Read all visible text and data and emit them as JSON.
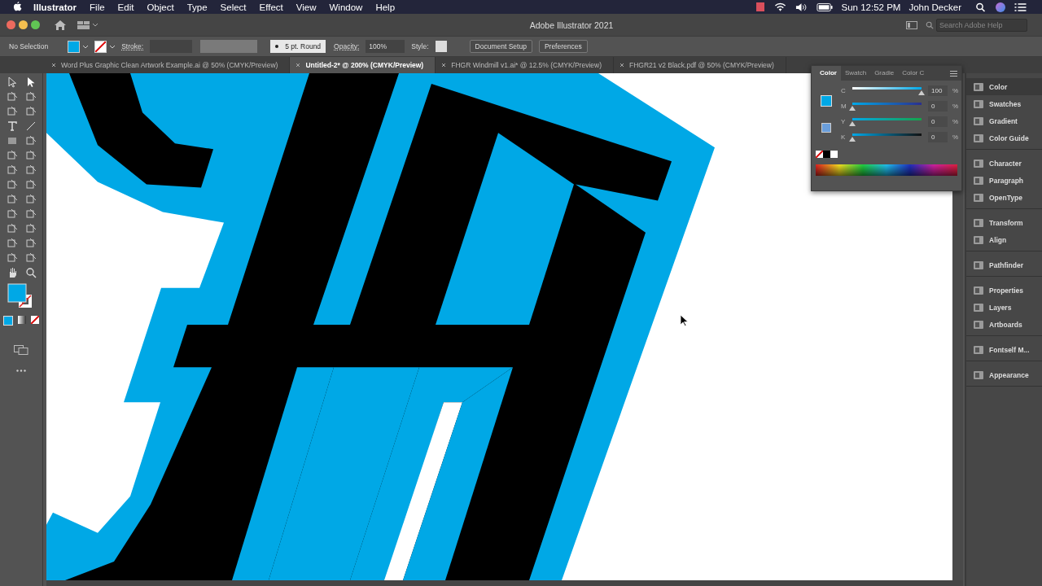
{
  "menu_bar": {
    "app": "Illustrator",
    "items": [
      "File",
      "Edit",
      "Object",
      "Type",
      "Select",
      "Effect",
      "View",
      "Window",
      "Help"
    ],
    "clock": "Sun 12:52 PM",
    "user": "John Decker"
  },
  "window": {
    "title": "Adobe Illustrator 2021",
    "search": {
      "placeholder": "Search Adobe Help"
    }
  },
  "control_bar": {
    "selection": "No Selection",
    "stroke_label": "Stroke:",
    "brush": "5 pt. Round",
    "opacity_label": "Opacity:",
    "opacity": "100%",
    "style_label": "Style:",
    "buttons": [
      "Document Setup",
      "Preferences"
    ]
  },
  "tabs": [
    {
      "label": "Word Plus Graphic Clean Artwork Example.ai @ 50% (CMYK/Preview)",
      "selected": false
    },
    {
      "label": "Untitled-2* @ 200% (CMYK/Preview)",
      "selected": true
    },
    {
      "label": "FHGR Windmill v1.ai* @ 12.5% (CMYK/Preview)",
      "selected": false
    },
    {
      "label": "FHGR21 v2 Black.pdf @ 50% (CMYK/Preview)",
      "selected": false
    }
  ],
  "color_panel": {
    "tabs": [
      {
        "label": "Color",
        "selected": true
      },
      {
        "label": "Swatch",
        "selected": false
      },
      {
        "label": "Gradie",
        "selected": false
      },
      {
        "label": "Color C",
        "selected": false
      }
    ],
    "channels": [
      {
        "name": "C",
        "level": 1,
        "value": "100",
        "unit": "%"
      },
      {
        "name": "M",
        "level": 0,
        "value": "0",
        "unit": "%"
      },
      {
        "name": "Y",
        "level": 0,
        "value": "0",
        "unit": "%"
      },
      {
        "name": "K",
        "level": 0,
        "value": "0",
        "unit": "%"
      }
    ]
  },
  "dock": [
    [
      {
        "label": "Color",
        "selected": true
      },
      {
        "label": "Swatches",
        "selected": false
      },
      {
        "label": "Gradient",
        "selected": false
      },
      {
        "label": "Color Guide",
        "selected": false
      }
    ],
    [
      {
        "label": "Character",
        "selected": false
      },
      {
        "label": "Paragraph",
        "selected": false
      },
      {
        "label": "OpenType",
        "selected": false
      }
    ],
    [
      {
        "label": "Transform",
        "selected": false
      },
      {
        "label": "Align",
        "selected": false
      }
    ],
    [
      {
        "label": "Pathfinder",
        "selected": false
      }
    ],
    [
      {
        "label": "Properties",
        "selected": false
      },
      {
        "label": "Layers",
        "selected": false
      },
      {
        "label": "Artboards",
        "selected": false
      }
    ],
    [
      {
        "label": "Fontself M...",
        "selected": false
      }
    ],
    [
      {
        "label": "Appearance",
        "selected": false
      }
    ]
  ]
}
